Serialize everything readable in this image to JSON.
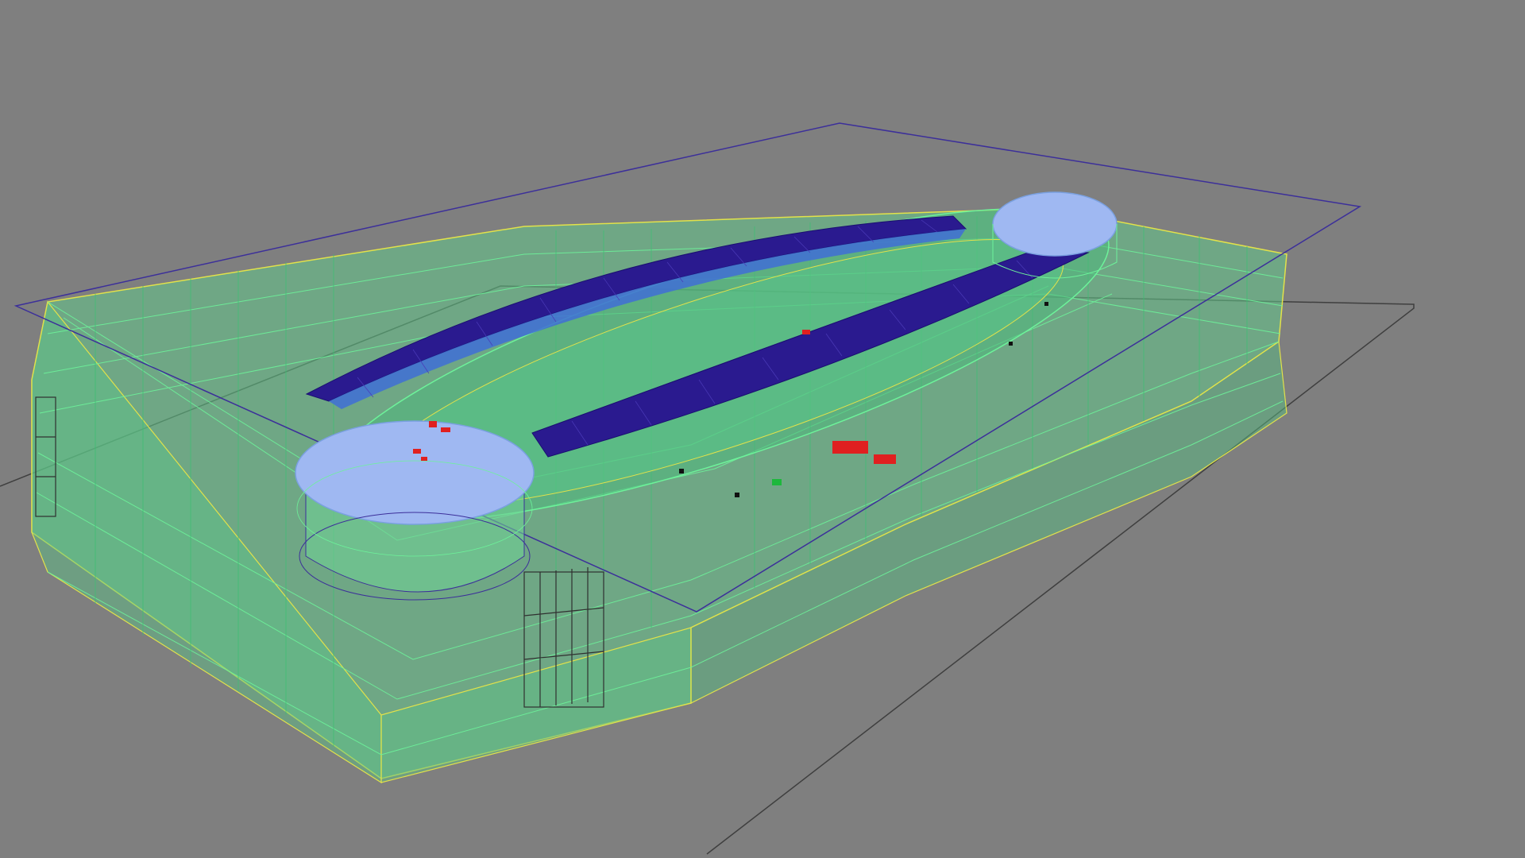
{
  "viewport": {
    "label": "",
    "background": "#7f7f7f"
  },
  "model": {
    "subject": "wireframe-building",
    "colors": {
      "ground_plane": "#3f3f3f",
      "roof_boundary": "#3c2f9a",
      "structure": "#6df29a",
      "structure_dark": "#3bbf72",
      "outline": "#e2e24a",
      "roof_truss": "#2a1a8f",
      "roof_truss_light": "#3f6fd6",
      "rotunda": "#9fb8f2",
      "highlight": "#e02020",
      "accent_green": "#1db83c",
      "mullion": "#303030"
    }
  }
}
